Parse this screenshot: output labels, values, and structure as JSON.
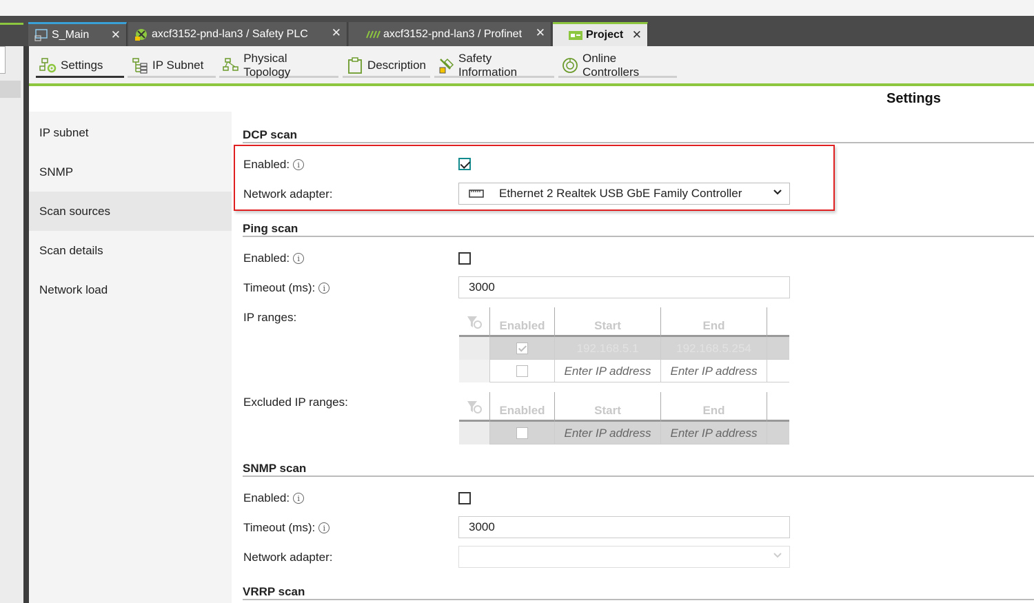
{
  "tabs": [
    {
      "label": "S_Main",
      "icon": "screen-icon"
    },
    {
      "label": "axcf3152-pnd-lan3 / Safety PLC",
      "icon": "safety-plc-icon"
    },
    {
      "label": "axcf3152-pnd-lan3 / Profinet",
      "icon": "profinet-icon"
    },
    {
      "label": "Project",
      "icon": "project-icon"
    }
  ],
  "toolbar": [
    {
      "label": "Settings",
      "icon": "settings-icon"
    },
    {
      "label": "IP Subnet",
      "icon": "ip-subnet-icon"
    },
    {
      "label": "Physical Topology",
      "icon": "topology-icon"
    },
    {
      "label": "Description",
      "icon": "clipboard-icon"
    },
    {
      "label": "Safety Information",
      "icon": "safety-info-icon"
    },
    {
      "label": "Online Controllers",
      "icon": "online-controllers-icon"
    }
  ],
  "page_title": "Settings",
  "sidenav": [
    "IP subnet",
    "SNMP",
    "Scan sources",
    "Scan details",
    "Network load"
  ],
  "dcp": {
    "title": "DCP scan",
    "enabled_label": "Enabled:",
    "enabled": true,
    "adapter_label": "Network adapter:",
    "adapter_value": "Ethernet 2 Realtek USB GbE Family Controller"
  },
  "ping": {
    "title": "Ping scan",
    "enabled_label": "Enabled:",
    "enabled": false,
    "timeout_label": "Timeout (ms):",
    "timeout_value": "3000",
    "ranges_label": "IP ranges:",
    "excluded_label": "Excluded IP ranges:",
    "columns": [
      "Enabled",
      "Start",
      "End"
    ],
    "ranges_rows": [
      {
        "enabled": true,
        "start": "192.168.5.1",
        "end": "192.168.5.254"
      },
      {
        "enabled": false,
        "start": "Enter IP address",
        "end": "Enter IP address"
      }
    ],
    "excluded_rows": [
      {
        "enabled": false,
        "start": "Enter IP address",
        "end": "Enter IP address"
      }
    ]
  },
  "snmp": {
    "title": "SNMP scan",
    "enabled_label": "Enabled:",
    "enabled": false,
    "timeout_label": "Timeout (ms):",
    "timeout_value": "3000",
    "adapter_label": "Network adapter:",
    "adapter_value": ""
  },
  "vrrp": {
    "title": "VRRP scan"
  },
  "colors": {
    "accent": "#8dc63f",
    "highlight_box": "#e02020",
    "checkbox_checked": "#118b8e"
  }
}
